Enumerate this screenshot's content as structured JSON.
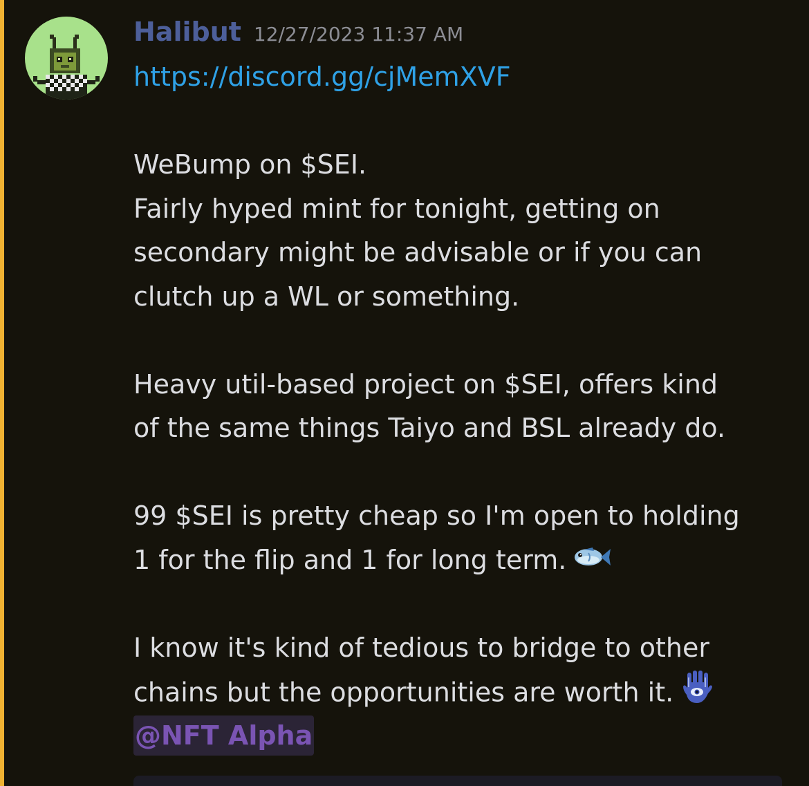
{
  "colors": {
    "background": "#15130b",
    "accent_bar": "#f0b232",
    "username": "#4d5f9a",
    "timestamp": "#8c8d94",
    "text": "#dcdde1",
    "link": "#2fa1e6",
    "mention_text": "#7a54b3",
    "mention_bg": "#2b2436",
    "avatar_bg": "#a8e18b"
  },
  "message": {
    "author": "Halibut",
    "timestamp": "12/27/2023 11:37 AM",
    "link": "https://discord.gg/cjMemXVF",
    "paragraphs": [
      [
        "WeBump on $SEI.",
        "Fairly hyped mint for tonight, getting on",
        "secondary might be advisable or if you can",
        "clutch up a WL or something."
      ],
      [
        "Heavy util-based project on $SEI, offers kind",
        "of the same things Taiyo and BSL already do."
      ],
      [
        "99 $SEI is pretty cheap so I'm open to holding",
        "1 for the flip and 1 for long term."
      ],
      [
        "I know it's kind of tedious to bridge to other",
        "chains but the opportunities are worth it."
      ]
    ],
    "mention": "@NFT Alpha",
    "emojis": [
      "fish-emoji",
      "hamsa-emoji"
    ],
    "avatar_icon": "pixel-bug-avatar-icon"
  }
}
